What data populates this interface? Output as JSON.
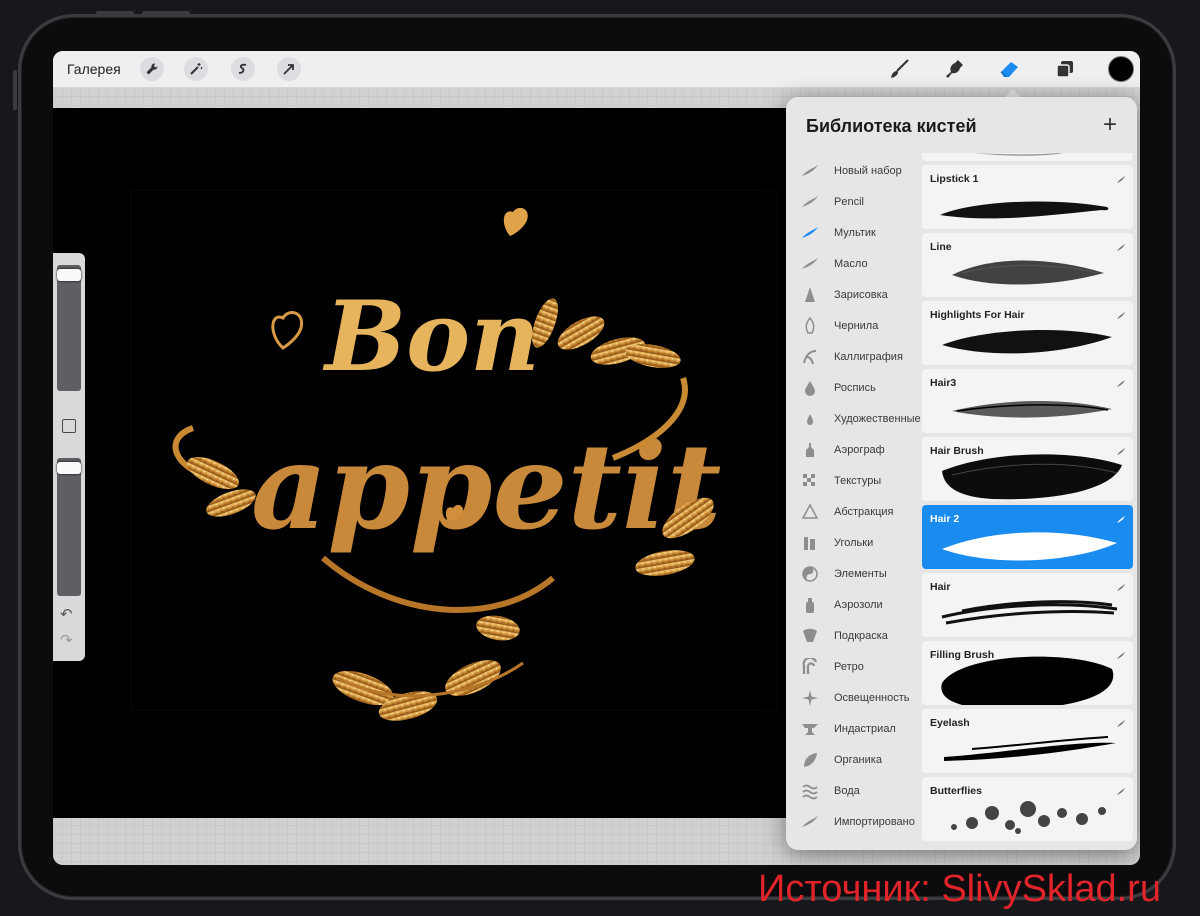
{
  "toolbar": {
    "gallery_label": "Галерея",
    "left_tools": [
      "wrench-icon",
      "magic-wand-icon",
      "selection-icon",
      "arrow-icon"
    ],
    "right_tools": [
      "brush-icon",
      "smudge-icon",
      "eraser-icon",
      "layers-icon"
    ],
    "active_tool": "eraser-icon",
    "current_color": "#000000",
    "accent_color": "#1a8cf0"
  },
  "artwork": {
    "line1": "Bon",
    "line2": "appetit",
    "colors": {
      "gold_light": "#f2c66b",
      "gold_dark": "#8a4d12"
    }
  },
  "brush_library": {
    "title": "Библиотека кистей",
    "add_label": "+",
    "sets": [
      {
        "label": "Новый набор",
        "icon": "brush-stroke-icon"
      },
      {
        "label": "Pencil",
        "icon": "brush-stroke-icon"
      },
      {
        "label": "Мультик",
        "icon": "brush-stroke-icon",
        "active": true
      },
      {
        "label": "Масло",
        "icon": "brush-stroke-icon"
      },
      {
        "label": "Зарисовка",
        "icon": "pencil-tip-icon"
      },
      {
        "label": "Чернила",
        "icon": "pen-nib-icon"
      },
      {
        "label": "Каллиграфия",
        "icon": "calligraphy-icon"
      },
      {
        "label": "Роспись",
        "icon": "paint-drop-icon"
      },
      {
        "label": "Художественные",
        "icon": "small-drop-icon"
      },
      {
        "label": "Аэрограф",
        "icon": "airbrush-icon"
      },
      {
        "label": "Текстуры",
        "icon": "checker-icon"
      },
      {
        "label": "Абстракция",
        "icon": "triangle-icon"
      },
      {
        "label": "Угольки",
        "icon": "charcoal-icon"
      },
      {
        "label": "Элементы",
        "icon": "yin-yang-icon"
      },
      {
        "label": "Аэрозоли",
        "icon": "spray-can-icon"
      },
      {
        "label": "Подкраска",
        "icon": "touchup-icon"
      },
      {
        "label": "Ретро",
        "icon": "retro-icon"
      },
      {
        "label": "Освещенность",
        "icon": "sparkle-icon"
      },
      {
        "label": "Индастриал",
        "icon": "anvil-icon"
      },
      {
        "label": "Органика",
        "icon": "leaf-icon"
      },
      {
        "label": "Вода",
        "icon": "waves-icon"
      },
      {
        "label": "Импортировано",
        "icon": "brush-stroke-icon"
      }
    ],
    "brushes": [
      {
        "name": "Lipstick  1"
      },
      {
        "name": "Line"
      },
      {
        "name": "Highlights For Hair"
      },
      {
        "name": "Hair3"
      },
      {
        "name": "Hair Brush"
      },
      {
        "name": "Hair 2",
        "selected": true
      },
      {
        "name": "Hair"
      },
      {
        "name": "Filling Brush"
      },
      {
        "name": "Eyelash"
      },
      {
        "name": "Butterflies"
      }
    ]
  },
  "watermark": "Источник: SlivySklad.ru"
}
